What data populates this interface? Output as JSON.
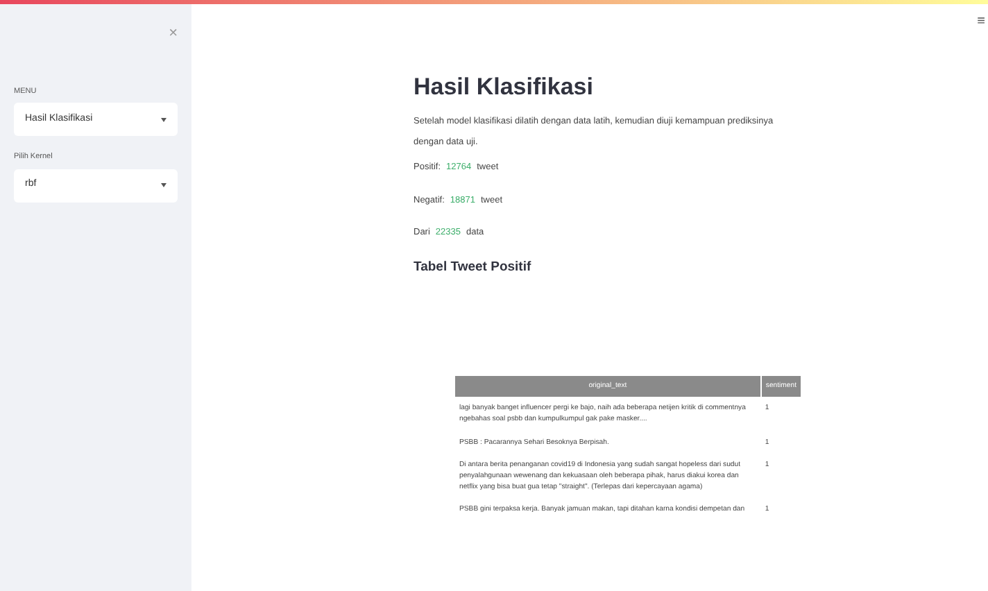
{
  "sidebar": {
    "close": "×",
    "menu_label": "MENU",
    "menu_value": "Hasil Klasifikasi",
    "kernel_label": "Pilih Kernel",
    "kernel_value": "rbf"
  },
  "main_menu": "≡",
  "title": "Hasil Klasifikasi",
  "description": "Setelah model klasifikasi dilatih dengan data latih, kemudian diuji kemampuan prediksinya dengan data uji.",
  "stats": [
    {
      "label": "Positif:",
      "value": "12764",
      "unit": "tweet"
    },
    {
      "label": "Negatif:",
      "value": "18871",
      "unit": "tweet"
    },
    {
      "label": "Dari",
      "value": "22335",
      "unit": "data"
    }
  ],
  "table_title": "Tabel Tweet Positif",
  "table": {
    "columns": [
      "original_text",
      "sentiment"
    ],
    "rows": [
      [
        "lagi banyak banget influencer pergi ke bajo, naih ada beberapa netijen kritik di commentnya ngebahas soal psbb dan kumpulkumpul gak pake masker....",
        "1"
      ],
      [
        "PSBB : Pacarannya Sehari Besoknya Berpisah.",
        "1"
      ],
      [
        "Di antara berita penanganan covid19 di Indonesia yang sudah sangat hopeless dari sudut penyalahgunaan wewenang dan kekuasaan oleh beberapa pihak, harus diakui korea dan netflix yang bisa buat gua tetap \"straight\". (Terlepas dari kepercayaan agama)",
        "1"
      ],
      [
        "PSBB gini terpaksa kerja. Banyak jamuan makan, tapi ditahan karna kondisi dempetan dan",
        "1"
      ]
    ]
  }
}
